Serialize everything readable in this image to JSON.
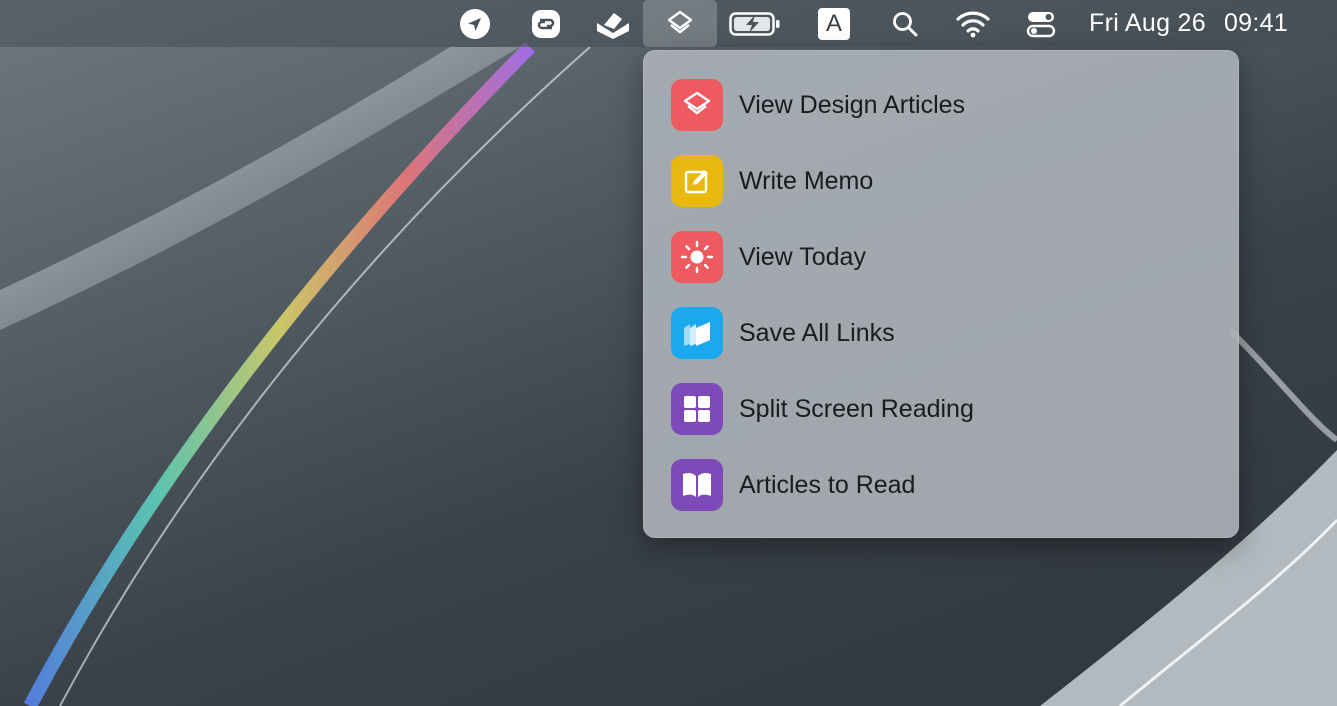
{
  "menubar": {
    "icons": [
      {
        "name": "location-arrow-icon"
      },
      {
        "name": "shortcuts-app-icon"
      },
      {
        "name": "reading-tray-icon"
      },
      {
        "name": "shortcuts-layers-icon",
        "active": true
      },
      {
        "name": "battery-charging-icon"
      },
      {
        "name": "input-source-icon",
        "label": "A"
      },
      {
        "name": "search-icon"
      },
      {
        "name": "wifi-icon"
      },
      {
        "name": "control-center-icon"
      }
    ],
    "date": "Fri Aug 26",
    "time": "09:41"
  },
  "menu": {
    "items": [
      {
        "label": "View Design Articles",
        "icon": "shortcut-layers-icon",
        "color": "#ef5a60"
      },
      {
        "label": "Write Memo",
        "icon": "compose-icon",
        "color": "#e9b80e"
      },
      {
        "label": "View Today",
        "icon": "sun-icon",
        "color": "#ee5a60"
      },
      {
        "label": "Save All Links",
        "icon": "stacked-books-icon",
        "color": "#1aa9ee"
      },
      {
        "label": "Split Screen Reading",
        "icon": "grid-icon",
        "color": "#7d4ab8"
      },
      {
        "label": "Articles to Read",
        "icon": "open-book-icon",
        "color": "#7d4ab8"
      }
    ]
  }
}
